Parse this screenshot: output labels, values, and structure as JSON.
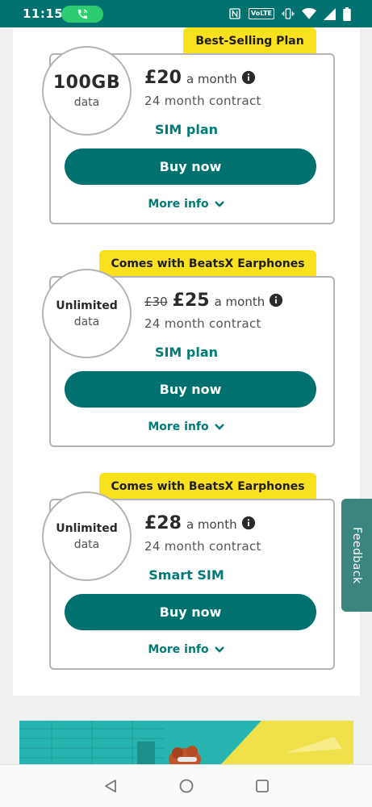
{
  "status_bar": {
    "time": "11:15",
    "volte_label": "VoLTE",
    "icons": [
      "call-icon",
      "nfc-icon",
      "volte-icon",
      "vibrate-icon",
      "wifi-icon",
      "signal-icon",
      "battery-icon"
    ]
  },
  "plans": [
    {
      "badge": "Best-Selling Plan",
      "data_amount": "100GB",
      "data_label": "data",
      "old_price": "",
      "price": "£20",
      "per": "a month",
      "contract": "24 month contract",
      "plan_type": "SIM plan",
      "buy_label": "Buy now",
      "more_label": "More info"
    },
    {
      "badge": "Comes with BeatsX Earphones",
      "data_amount": "Unlimited",
      "data_label": "data",
      "old_price": "£30",
      "price": "£25",
      "per": "a month",
      "contract": "24 month contract",
      "plan_type": "SIM plan",
      "buy_label": "Buy now",
      "more_label": "More info"
    },
    {
      "badge": "Comes with BeatsX Earphones",
      "data_amount": "Unlimited",
      "data_label": "data",
      "old_price": "",
      "price": "£28",
      "per": "a month",
      "contract": "24 month contract",
      "plan_type": "Smart SIM",
      "buy_label": "Buy now",
      "more_label": "More info"
    }
  ],
  "feedback_label": "Feedback",
  "colors": {
    "brand": "#00716f",
    "accent_yellow": "#f9e11e",
    "teal_text": "#007b77",
    "card_border": "#b4b4b4"
  },
  "nav": {
    "icons": [
      "back-icon",
      "home-icon",
      "recents-icon"
    ]
  }
}
